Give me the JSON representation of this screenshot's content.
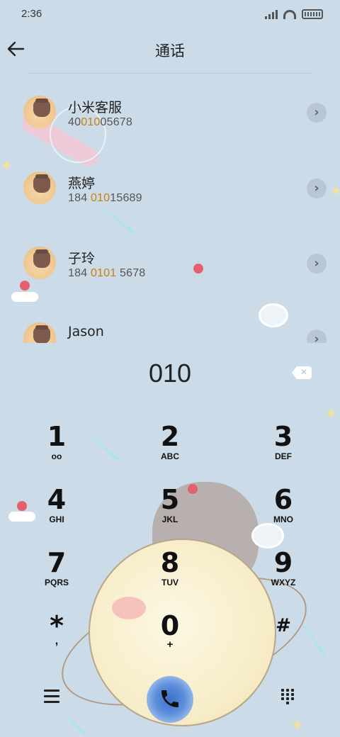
{
  "status_bar": {
    "time": "2:36"
  },
  "header": {
    "title": "通话"
  },
  "contacts": [
    {
      "name": "小米客服",
      "number_pre": "40",
      "number_hl": "010",
      "number_post": "05678"
    },
    {
      "name": "燕婷",
      "number_pre": "184 ",
      "number_hl": "010",
      "number_post": "15689"
    },
    {
      "name": "子玲",
      "number_pre": "184 ",
      "number_hl": "0101",
      "number_post": " 5678"
    },
    {
      "name": "Jason",
      "number_pre": "",
      "number_hl": "",
      "number_post": ""
    }
  ],
  "dial": {
    "number": "010"
  },
  "keypad": [
    {
      "digit": "1",
      "letters": "oo"
    },
    {
      "digit": "2",
      "letters": "ABC"
    },
    {
      "digit": "3",
      "letters": "DEF"
    },
    {
      "digit": "4",
      "letters": "GHI"
    },
    {
      "digit": "5",
      "letters": "JKL"
    },
    {
      "digit": "6",
      "letters": "MNO"
    },
    {
      "digit": "7",
      "letters": "PQRS"
    },
    {
      "digit": "8",
      "letters": "TUV"
    },
    {
      "digit": "9",
      "letters": "WXYZ"
    },
    {
      "digit": "*",
      "letters": ","
    },
    {
      "digit": "0",
      "letters": "+"
    },
    {
      "digit": "#",
      "letters": ""
    }
  ],
  "colors": {
    "background": "#ccdbe8",
    "highlight": "#c8800c",
    "call_button": "#3d6fc9"
  },
  "icons": {
    "back": "arrow-left-icon",
    "delete": "backspace-icon",
    "menu": "menu-icon",
    "call": "phone-icon",
    "dialpad": "dialpad-icon",
    "chevron": "chevron-right-icon"
  }
}
